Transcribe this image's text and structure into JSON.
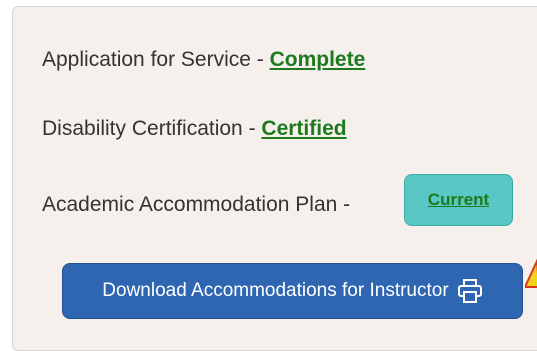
{
  "status_rows": [
    {
      "label": "Application for Service - ",
      "status": "Complete"
    },
    {
      "label": "Disability Certification - ",
      "status": "Certified"
    },
    {
      "label": "Academic Accommodation Plan - ",
      "status": "Current"
    }
  ],
  "download_button": {
    "label": "Download Accommodations for Instructor",
    "icon": "printer-icon"
  },
  "colors": {
    "card_background": "#f5f0ec",
    "status_green": "#1e7a1e",
    "badge_teal": "#59c7c4",
    "button_blue": "#2f66b2",
    "warning_yellow": "#f2d21b",
    "warning_red": "#d9381e"
  }
}
